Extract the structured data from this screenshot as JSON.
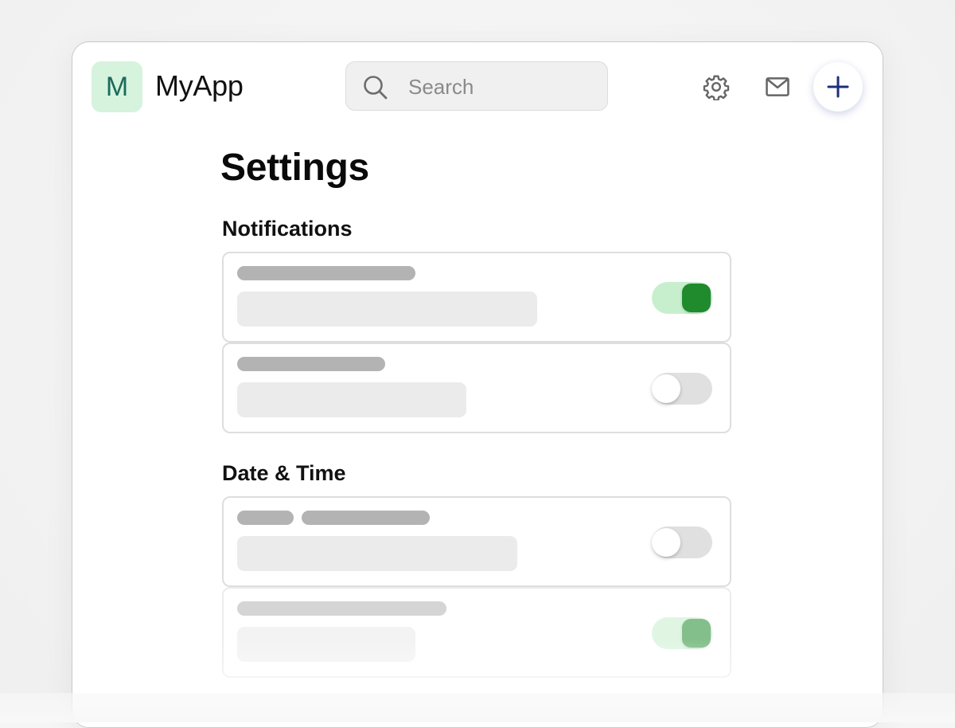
{
  "app": {
    "logo_letter": "M",
    "title": "MyApp"
  },
  "search": {
    "placeholder": "Search",
    "value": ""
  },
  "header": {
    "icons": [
      "gear-icon",
      "mail-icon",
      "plus-icon"
    ]
  },
  "page": {
    "title": "Settings"
  },
  "sections": [
    {
      "heading": "Notifications",
      "rows": [
        {
          "toggle": "on"
        },
        {
          "toggle": "off"
        }
      ]
    },
    {
      "heading": "Date & Time",
      "rows": [
        {
          "toggle": "off"
        },
        {
          "toggle": "on"
        }
      ]
    }
  ],
  "colors": {
    "accent_green": "#1f8b2c",
    "toggle_on_track": "#c7efcd",
    "logo_bg": "#d6f3dd",
    "logo_letter": "#1a6b5c",
    "add_icon": "#1d2f7a"
  }
}
